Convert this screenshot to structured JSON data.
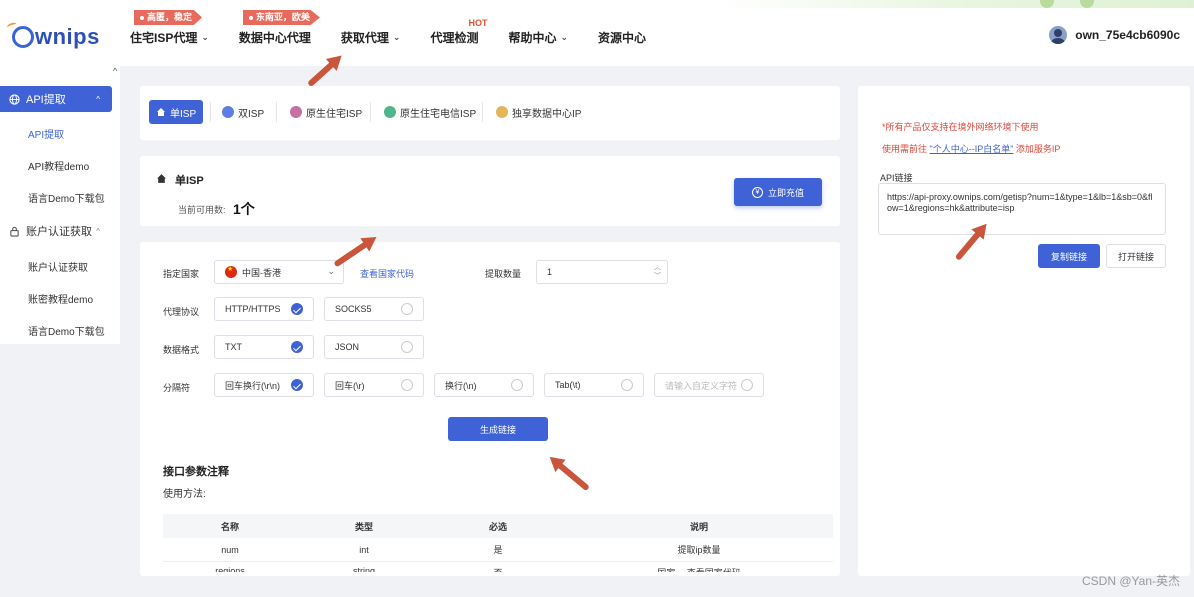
{
  "header": {
    "logo_text": "wnips",
    "nav": [
      {
        "label": "住宅ISP代理",
        "has_chevron": true,
        "tag": "高匿，稳定"
      },
      {
        "label": "数据中心代理",
        "has_chevron": false,
        "tag": "东南亚，欧美"
      },
      {
        "label": "获取代理",
        "has_chevron": true
      },
      {
        "label": "代理检测",
        "has_chevron": false,
        "badge": "HOT"
      },
      {
        "label": "帮助中心",
        "has_chevron": true
      },
      {
        "label": "资源中心",
        "has_chevron": false
      }
    ],
    "chevron": "⌄",
    "username": "own_75e4cb6090c"
  },
  "sidebar": {
    "collapse_arrow": "^",
    "groups": [
      {
        "label": "API提取",
        "icon": "globe-icon",
        "caret": "^",
        "items": [
          "API提取",
          "API教程demo",
          "语言Demo下载包"
        ]
      },
      {
        "label": "账户认证获取",
        "icon": "lock-icon",
        "caret": "^",
        "items": [
          "账户认证获取",
          "账密教程demo",
          "语言Demo下载包"
        ]
      }
    ]
  },
  "tabs": [
    {
      "label": "单ISP",
      "active": true
    },
    {
      "label": "双ISP",
      "active": false
    },
    {
      "label": "原生住宅ISP",
      "active": false
    },
    {
      "label": "原生住宅电信ISP",
      "active": false
    },
    {
      "label": "独享数据中心IP",
      "active": false
    }
  ],
  "info": {
    "title": "单ISP",
    "available_label": "当前可用数:",
    "available_count": "1个",
    "recharge_label": "立即充值",
    "recharge_icon": "¥"
  },
  "form": {
    "country_label": "指定国家",
    "country_value": "中国-香港",
    "country_code_link": "查看国家代码",
    "quantity_label": "提取数量",
    "quantity_value": "1",
    "protocol_label": "代理协议",
    "protocols": [
      {
        "label": "HTTP/HTTPS",
        "checked": true
      },
      {
        "label": "SOCKS5",
        "checked": false
      }
    ],
    "format_label": "数据格式",
    "formats": [
      {
        "label": "TXT",
        "checked": true
      },
      {
        "label": "JSON",
        "checked": false
      }
    ],
    "separator_label": "分隔符",
    "separators": [
      {
        "label": "回车换行(\\r\\n)",
        "checked": true
      },
      {
        "label": "回车(\\r)",
        "checked": false
      },
      {
        "label": "换行(\\n)",
        "checked": false
      },
      {
        "label": "Tab(\\t)",
        "checked": false
      }
    ],
    "custom_placeholder": "请输入自定义字符",
    "generate_label": "生成链接"
  },
  "params": {
    "title": "接口参数注释",
    "subtitle": "使用方法:",
    "columns": [
      "名称",
      "类型",
      "必选",
      "说明"
    ],
    "rows": [
      [
        "num",
        "int",
        "是",
        "提取ip数量"
      ],
      [
        "regions",
        "string",
        "否",
        "国家，  查看国家代码"
      ]
    ]
  },
  "api": {
    "warning1": "*所有产品仅支持在境外网络环境下使用",
    "warning2_prefix": "使用需前往 ",
    "warning2_link": "\"个人中心--IP白名单\"",
    "warning2_suffix": " 添加服务IP",
    "label": "API链接",
    "url": "https://api-proxy.ownips.com/getisp?num=1&type=1&lb=1&sb=0&flow=1&regions=hk&attribute=isp",
    "copy_label": "复制链接",
    "open_label": "打开链接"
  },
  "watermark": "CSDN @Yan-英杰",
  "accent_color": "#3f63d6",
  "annotation_color": "#c9553a"
}
